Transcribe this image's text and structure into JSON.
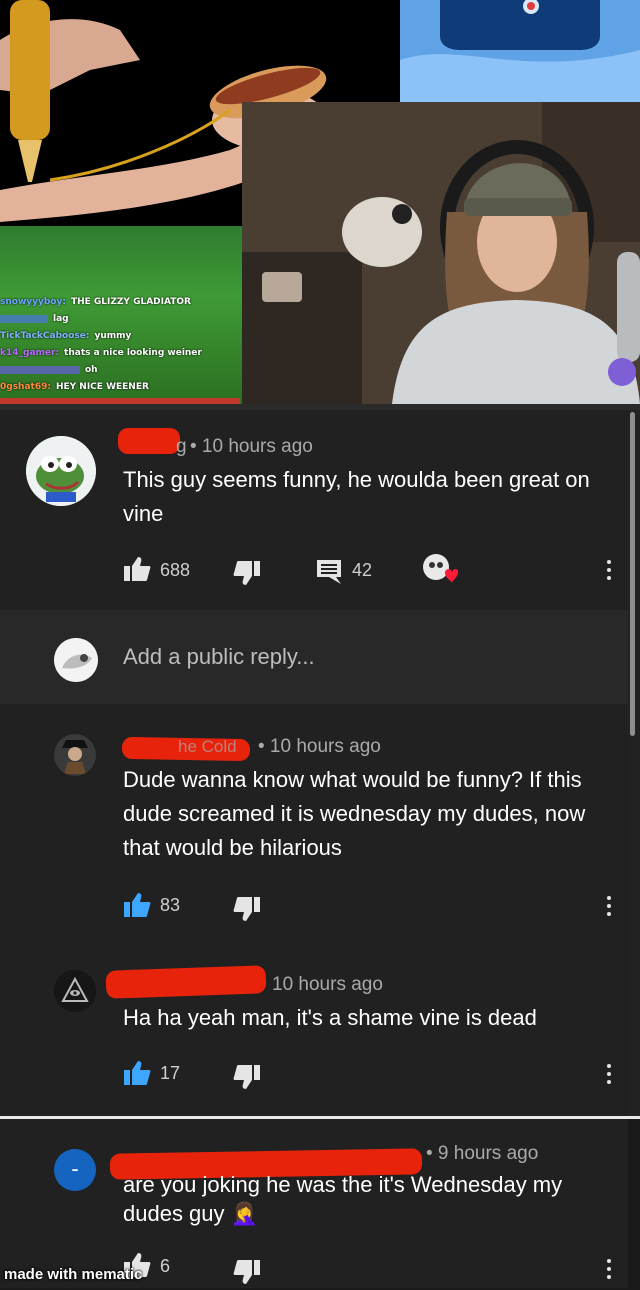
{
  "stream": {
    "chat": [
      {
        "user": "snowyyyboy:",
        "user_color": "#6aa5ff",
        "message": "THE GLIZZY GLADIATOR"
      },
      {
        "user": "",
        "user_color": "#4c6fff",
        "message": "lag"
      },
      {
        "user": "TickTackCaboose:",
        "user_color": "#7fb3ff",
        "message": "yummy"
      },
      {
        "user": "k14_gamer:",
        "user_color": "#b86bff",
        "message": "thats a nice looking weiner"
      },
      {
        "user": "",
        "user_color": "#6f58ff",
        "message": "oh"
      },
      {
        "user": "0gshat69:",
        "user_color": "#ff8a3d",
        "message": "HEY NICE WEENER"
      }
    ]
  },
  "top_comment": {
    "author_visible": "g",
    "time": "• 10 hours ago",
    "text": "This guy seems funny, he woulda been great on vine",
    "likes": "688",
    "replies": "42",
    "avatar_icon": "frog-avatar"
  },
  "reply_box": {
    "placeholder": "Add a public reply..."
  },
  "replies": [
    {
      "author_visible": "he Cold",
      "time": "• 10 hours ago",
      "text": "Dude wanna know what would be funny? If this dude screamed it is wednesday my dudes, now that would be hilarious",
      "likes": "83"
    },
    {
      "author_visible": "",
      "time": "10 hours ago",
      "text": "Ha ha yeah man, it's a shame vine is dead",
      "likes": "17"
    },
    {
      "author_visible": "",
      "time": "• 9 hours ago",
      "text": "are you joking he was the it's Wednesday my dudes guy",
      "emoji": "🤦‍♀️",
      "likes": "6",
      "avatar_letter": "-"
    }
  ],
  "watermark": "made with mematic",
  "colors": {
    "accent_like": "#3ea6ff",
    "redaction": "#e8230c",
    "avatar_blue": "#1565c0"
  }
}
